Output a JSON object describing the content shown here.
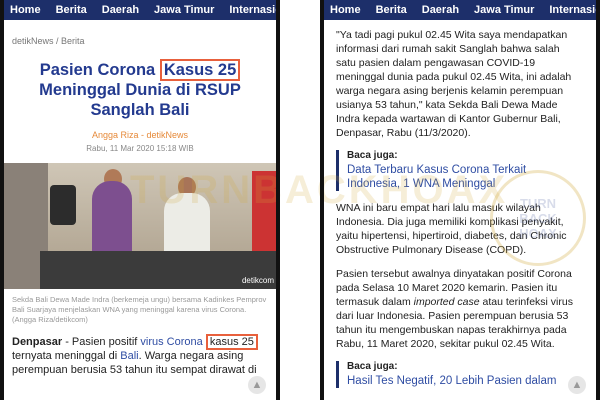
{
  "nav": {
    "left": [
      "Home",
      "Berita",
      "Daerah",
      "Jawa Timur",
      "Internasional"
    ],
    "right": [
      "Home",
      "Berita",
      "Daerah",
      "Jawa Timur",
      "Internasio"
    ]
  },
  "breadcrumb": "detikNews / Berita",
  "title": {
    "part1": "Pasien Corona",
    "highlight": "Kasus 25",
    "part2": "Meninggal Dunia di RSUP Sanglah Bali"
  },
  "author": "Angga Riza - detikNews",
  "date": "Rabu, 11 Mar 2020 15:18 WIB",
  "photo_tag": "detikcom",
  "caption": "Sekda Bali Dewa Made Indra (berkemeja ungu) bersama Kadinkes Pemprov Bali Suarjaya menjelaskan WNA yang meninggal karena virus Corona. (Angga Riza/detikcom)",
  "lead": {
    "place": "Denpasar",
    "t1": " - Pasien positif ",
    "link1": "virus Corona",
    "t2": " ",
    "highlight": "kasus 25",
    "t3": " ternyata meninggal di ",
    "link2": "Bali",
    "t4": ". Warga negara asing perempuan berusia 53 tahun itu sempat dirawat di"
  },
  "right": {
    "quote": "\"Ya tadi pagi pukul 02.45 Wita saya mendapatkan informasi dari rumah sakit Sanglah bahwa salah satu pasien dalam pengawasan COVID-19 meninggal dunia pada pukul 02.45 Wita, ini adalah warga negara asing berjenis kelamin perempuan usianya 53 tahun,\" kata Sekda Bali Dewa Made Indra kepada wartawan di Kantor Gubernur Bali, Denpasar, Rabu (11/3/2020).",
    "baca1_label": "Baca juga:",
    "baca1_link": "Data Terbaru Kasus Corona Terkait Indonesia, 1 WNA Meninggal",
    "para2": "WNA ini baru empat hari lalu masuk wilayah Indonesia. Dia juga memiliki komplikasi penyakit, yaitu hipertensi, hipertiroid, diabetes, dan Chronic Obstructive Pulmonary Disease (COPD).",
    "para3a": "Pasien tersebut awalnya dinyatakan positif Corona pada Selasa 10 Maret 2020 kemarin. Pasien itu termasuk dalam ",
    "para3_italic": "imported case",
    "para3b": " atau terinfeksi virus dari luar Indonesia. Pasien perempuan berusia 53 tahun itu mengembuskan napas terakhirnya pada Rabu, 11 Maret 2020, sekitar pukul 02.45 Wita.",
    "baca2_label": "Baca juga:",
    "baca2_link": "Hasil Tes Negatif, 20 Lebih Pasien dalam"
  },
  "watermark": {
    "text": "TURNBACKHOAX",
    "seal": "TURN BACK HOAX"
  },
  "colors": {
    "nav": "#1d2f6a",
    "title": "#233a8f",
    "highlight_box": "#e8603c",
    "link": "#2f4da3",
    "author": "#e68a3a"
  },
  "icons": [
    "arrow-up-icon"
  ]
}
